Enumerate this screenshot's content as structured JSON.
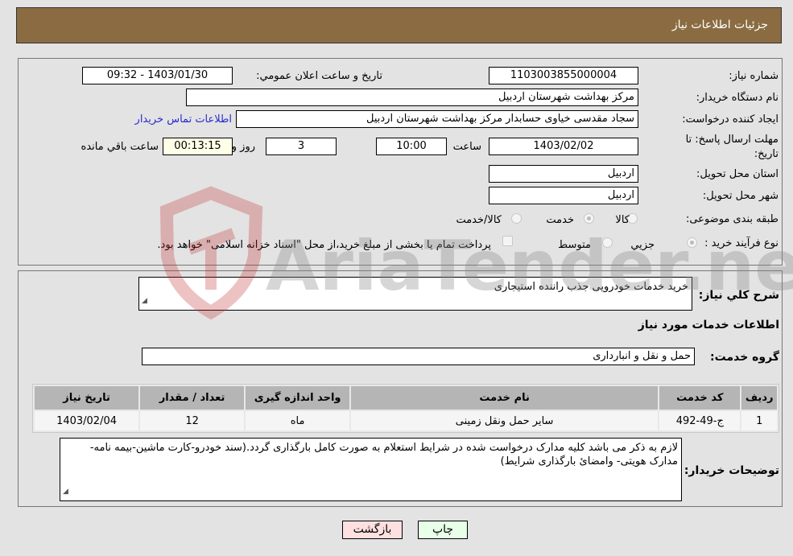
{
  "header": {
    "title": "جزئیات اطلاعات نیاز"
  },
  "fields": {
    "need_number_label": "شماره نیاز:",
    "need_number": "1103003855000004",
    "announce_label": "تاریخ و ساعت اعلان عمومي:",
    "announce_value": "1403/01/30 - 09:32",
    "buyer_org_label": "نام دستگاه خریدار:",
    "buyer_org": "مرکز بهداشت شهرستان اردبیل",
    "creator_label": "ایجاد کننده درخواست:",
    "creator": "سجاد مقدسی خیاوی حسابدار مرکز بهداشت شهرستان اردبیل",
    "buyer_contact_link": "اطلاعات تماس خریدار",
    "deadline_label_1": "مهلت ارسال پاسخ: تا",
    "deadline_label_2": "تاریخ:",
    "deadline_date": "1403/02/02",
    "time_label": "ساعت",
    "deadline_time": "10:00",
    "days_value": "3",
    "days_label": "روز و",
    "remaining_time": "00:13:15",
    "remaining_label": "ساعت باقي مانده",
    "province_label": "استان محل تحویل:",
    "province": "اردبیل",
    "city_label": "شهر محل تحویل:",
    "city": "اردبیل",
    "category_label": "طبقه بندی موضوعی:",
    "category_options": [
      "کالا",
      "خدمت",
      "کالا/خدمت"
    ],
    "category_selected": "خدمت",
    "process_label": "نوع فرآیند خرید :",
    "process_options": [
      "جزيي",
      "متوسط"
    ],
    "process_selected": "جزيي",
    "treasury_note": "پرداخت تمام یا بخشی از مبلغ خرید،از محل \"اسناد خزانه اسلامی\" خواهد بود."
  },
  "description": {
    "label": "شرح کلي نیاز:",
    "value": "خرید خدمات خودرویی جذب راننده استیجاری"
  },
  "services": {
    "section_title": "اطلاعات خدمات مورد نیاز",
    "group_label": "گروه خدمت:",
    "group_value": "حمل و نقل و انبارداری",
    "table": {
      "headers": [
        "ردیف",
        "کد خدمت",
        "نام خدمت",
        "واحد اندازه گیری",
        "تعداد / مقدار",
        "تاریخ نیاز"
      ],
      "rows": [
        [
          "1",
          "ج-49-492",
          "سایر حمل ونقل زمینی",
          "ماه",
          "12",
          "1403/02/04"
        ]
      ]
    }
  },
  "buyer_notes": {
    "label": "توضیحات خریدار:",
    "value": "لازم به ذکر می باشد کلیه مدارک درخواست شده در شرایط استعلام به صورت کامل بارگذاری گردد.(سند خودرو-کارت ماشین-بیمه نامه-مدارک هویتی- وامضائ بارگذاری شرایط)"
  },
  "buttons": {
    "print": "چاپ",
    "back": "بازگشت"
  },
  "watermark": {
    "text": "AriaTender.neT"
  },
  "colors": {
    "header_bg": "#8b6c42",
    "print_bg": "#e8ffe8",
    "back_bg": "#ffe0e0",
    "remaining_bg": "#ffffe8",
    "link": "#2a2ad0"
  }
}
